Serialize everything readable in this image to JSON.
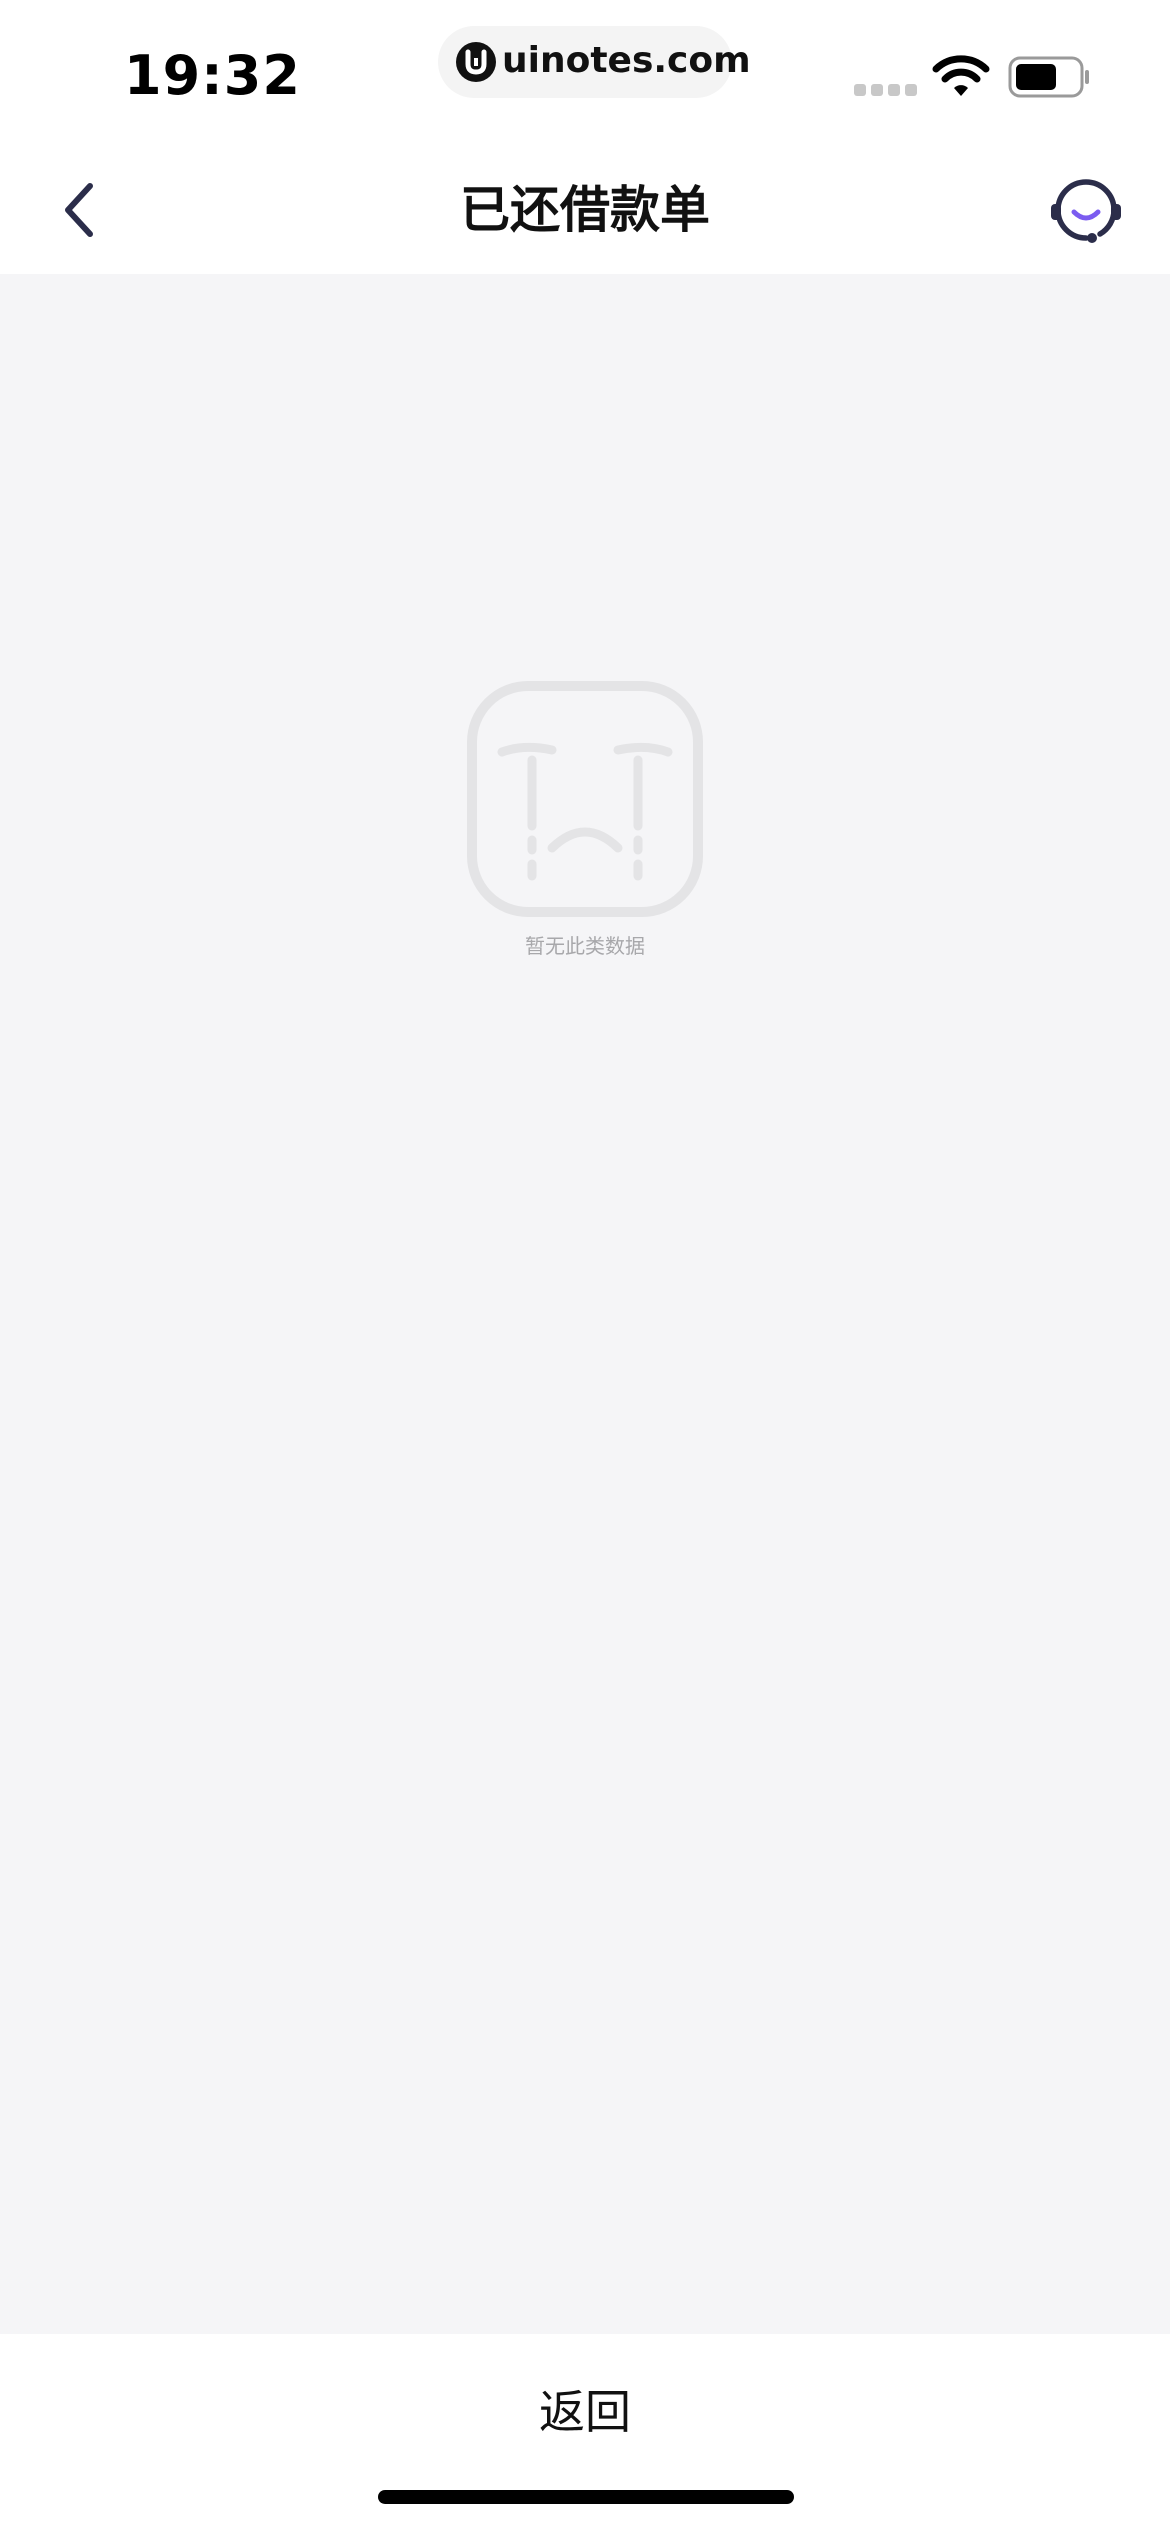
{
  "status_bar": {
    "time": "19:32",
    "url": "uinotes.com",
    "icons": [
      "cellular-signal-icon",
      "wifi-icon",
      "battery-icon"
    ]
  },
  "nav": {
    "title": "已还借款单",
    "back_icon": "chevron-left-icon",
    "support_icon": "customer-service-headset-icon"
  },
  "empty_state": {
    "icon": "crying-face-icon",
    "message": "暂无此类数据"
  },
  "bottom": {
    "return_label": "返回"
  },
  "colors": {
    "nav_background": "#ffffff",
    "page_background": "#f5f5f7",
    "accent_purple": "#7b5cf0",
    "icon_dark": "#2b2d4a",
    "empty_gray": "#e4e4e6"
  }
}
